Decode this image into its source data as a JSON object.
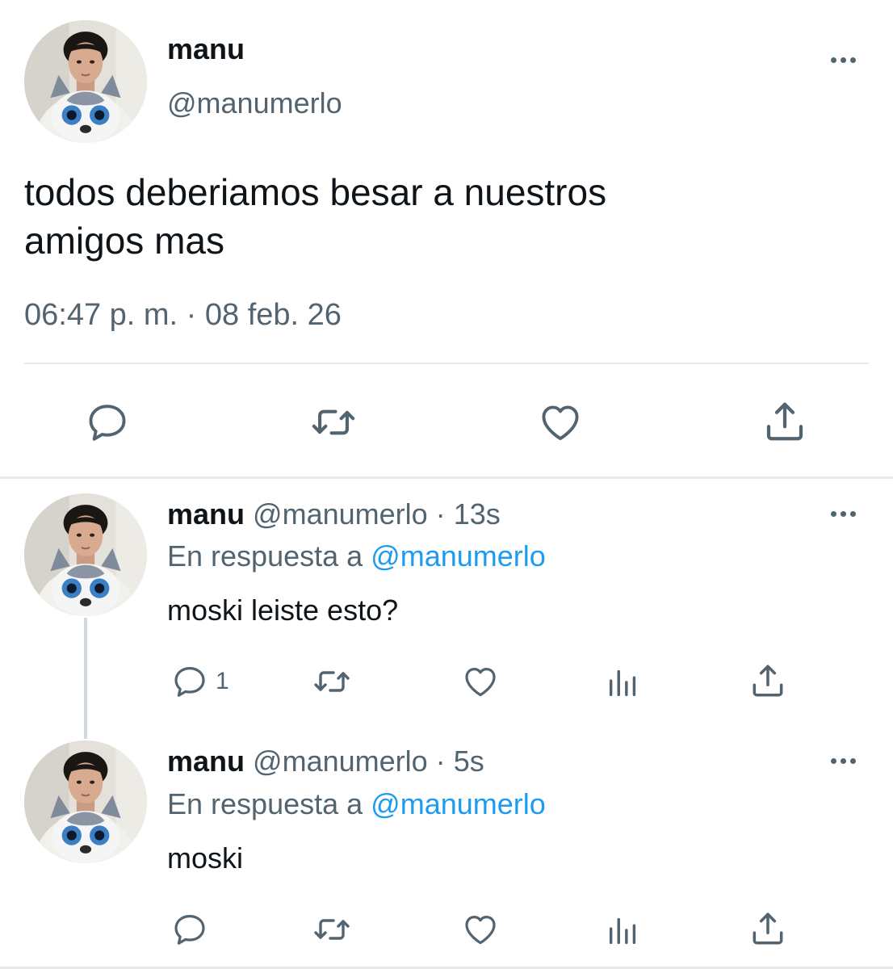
{
  "main_tweet": {
    "display_name": "manu",
    "handle": "@manumerlo",
    "text_line1": "todos deberiamos besar a nuestros",
    "text_line2": "amigos mas",
    "timestamp": "06:47 p. m. · 08 feb. 26",
    "actions": [
      "reply-icon",
      "retweet-icon",
      "like-icon",
      "share-icon"
    ]
  },
  "replies": [
    {
      "display_name": "manu",
      "handle": "@manumerlo",
      "separator": "·",
      "time": "13s",
      "reply_prefix": "En respuesta a",
      "reply_to": "@manumerlo",
      "text": "moski leiste esto?",
      "reply_count": "1",
      "actions": [
        "reply-icon",
        "retweet-icon",
        "like-icon",
        "views-icon",
        "share-icon"
      ]
    },
    {
      "display_name": "manu",
      "handle": "@manumerlo",
      "separator": "·",
      "time": "5s",
      "reply_prefix": "En respuesta a",
      "reply_to": "@manumerlo",
      "text": "moski",
      "reply_count": "",
      "actions": [
        "reply-icon",
        "retweet-icon",
        "like-icon",
        "views-icon",
        "share-icon"
      ]
    }
  ],
  "colors": {
    "text": "#0f1419",
    "muted": "#536471",
    "link": "#1d9bf0",
    "divider": "#e6e9eb"
  }
}
